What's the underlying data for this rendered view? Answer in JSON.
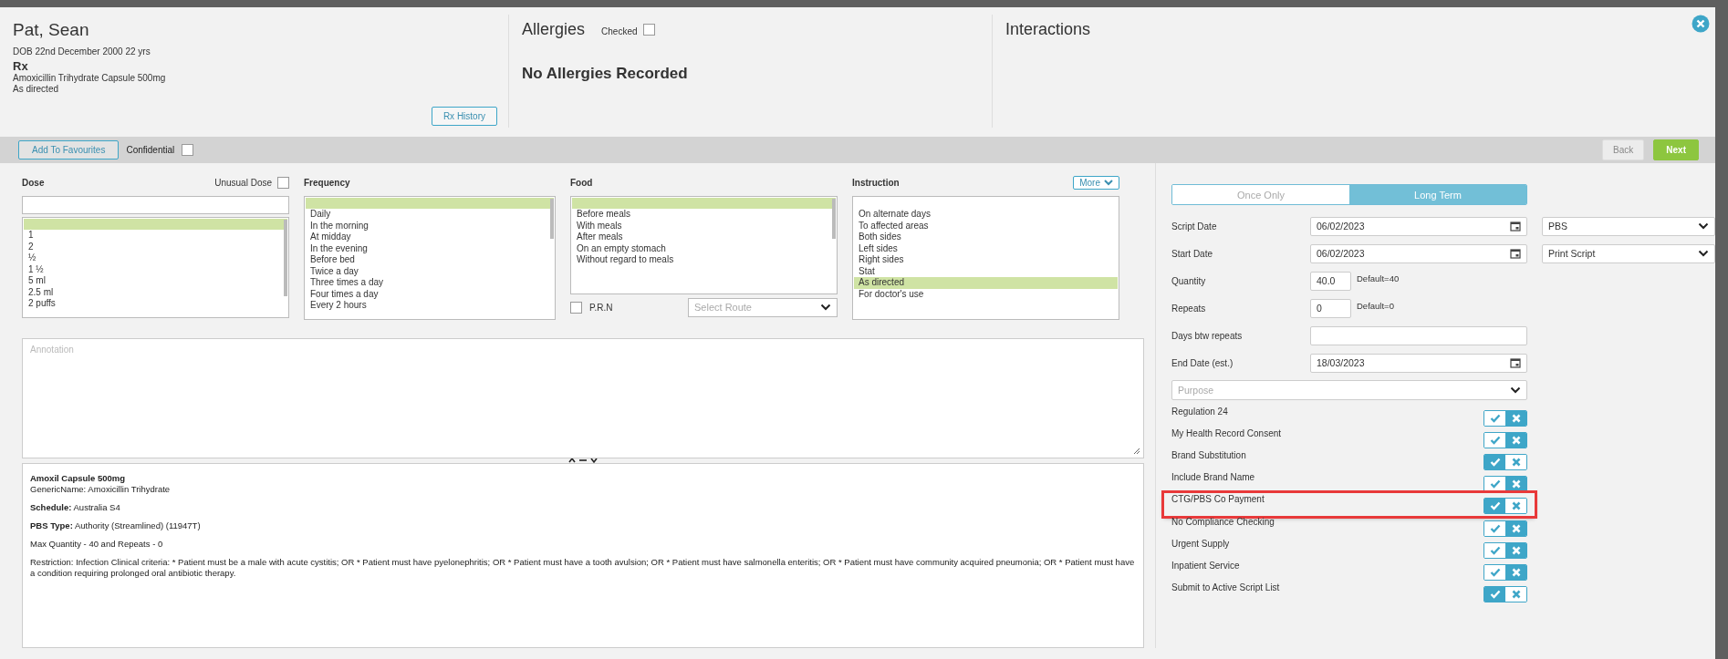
{
  "patient": {
    "name": "Pat, Sean",
    "dob": "DOB 22nd December 2000 22 yrs",
    "rx_heading": "Rx",
    "drug": "Amoxicillin Trihydrate Capsule 500mg",
    "directions": "As directed",
    "history_button": "Rx History"
  },
  "allergies": {
    "title": "Allergies",
    "checked_label": "Checked",
    "checked": false,
    "message": "No Allergies Recorded"
  },
  "interactions": {
    "title": "Interactions"
  },
  "toolbar": {
    "favourites_button": "Add To Favourites",
    "confidential_label": "Confidential",
    "confidential": false,
    "back_button": "Back",
    "next_button": "Next"
  },
  "dose": {
    "title": "Dose",
    "unusual_label": "Unusual Dose",
    "unusual": false,
    "blank_row": {
      "selected": true
    },
    "items": [
      {
        "label": "1",
        "selected": false
      },
      {
        "label": "2",
        "selected": false
      },
      {
        "label": "½",
        "selected": false
      },
      {
        "label": "1 ½",
        "selected": false
      },
      {
        "label": "5 ml",
        "selected": false
      },
      {
        "label": "2.5 ml",
        "selected": false
      },
      {
        "label": "2 puffs",
        "selected": false
      }
    ]
  },
  "frequency": {
    "title": "Frequency",
    "blank_row": {
      "selected": true
    },
    "items": [
      {
        "label": "Daily",
        "selected": false
      },
      {
        "label": "In the morning",
        "selected": false
      },
      {
        "label": "At midday",
        "selected": false
      },
      {
        "label": "In the evening",
        "selected": false
      },
      {
        "label": "Before bed",
        "selected": false
      },
      {
        "label": "Twice a day",
        "selected": false
      },
      {
        "label": "Three times a day",
        "selected": false
      },
      {
        "label": "Four times a day",
        "selected": false
      },
      {
        "label": "Every 2 hours",
        "selected": false
      }
    ]
  },
  "food": {
    "title": "Food",
    "blank_row": {
      "selected": true
    },
    "items": [
      {
        "label": "Before meals",
        "selected": false
      },
      {
        "label": "With meals",
        "selected": false
      },
      {
        "label": "After meals",
        "selected": false
      },
      {
        "label": "On an empty stomach",
        "selected": false
      },
      {
        "label": "Without regard to meals",
        "selected": false
      }
    ],
    "prn_label": "P.R.N",
    "prn": false,
    "route_placeholder": "Select Route"
  },
  "instruction": {
    "title": "Instruction",
    "more_button": "More",
    "blank_row": {
      "selected": false
    },
    "items": [
      {
        "label": "On alternate days",
        "selected": false
      },
      {
        "label": "To affected areas",
        "selected": false
      },
      {
        "label": "Both sides",
        "selected": false
      },
      {
        "label": "Left sides",
        "selected": false
      },
      {
        "label": "Right sides",
        "selected": false
      },
      {
        "label": "Stat",
        "selected": false
      },
      {
        "label": "As directed",
        "selected": true
      },
      {
        "label": "For doctor's use",
        "selected": false
      }
    ]
  },
  "annotation": {
    "placeholder": "Annotation"
  },
  "drug_info": {
    "title": "Amoxil Capsule 500mg",
    "generic": "GenericName: Amoxicillin Trihydrate",
    "paragraphs": [
      "**Schedule:** Australia S4",
      "**PBS Type:** Authority (Streamlined) (11947T)",
      "Max Quantity - 40 and Repeats - 0",
      "Restriction: Infection Clinical criteria: * Patient must be a male with acute cystitis; OR * Patient must have pyelonephritis; OR * Patient must have a tooth avulsion; OR * Patient must have salmonella enteritis; OR * Patient must have community acquired pneumonia; OR * Patient must have a condition requiring prolonged oral antibiotic therapy."
    ]
  },
  "term_tabs": [
    {
      "label": "Once Only",
      "selected": false
    },
    {
      "label": "Long Term",
      "selected": true
    }
  ],
  "form_rows": [
    {
      "kind": "date",
      "label": "Script Date",
      "value": "06/02/2023",
      "side_select": "PBS"
    },
    {
      "kind": "date",
      "label": "Start Date",
      "value": "06/02/2023",
      "side_select": "Print Script"
    },
    {
      "kind": "number",
      "label": "Quantity",
      "value": "40.0",
      "hint": "Default=40"
    },
    {
      "kind": "number",
      "label": "Repeats",
      "value": "0",
      "hint": "Default=0"
    },
    {
      "kind": "text",
      "label": "Days btw repeats"
    },
    {
      "kind": "date",
      "label": "End Date (est.)",
      "value": "18/03/2023"
    }
  ],
  "purpose": {
    "placeholder": "Purpose"
  },
  "options": [
    {
      "label": "Regulation 24",
      "on": false,
      "highlighted": false
    },
    {
      "label": "My Health Record Consent",
      "on": false,
      "highlighted": false
    },
    {
      "label": "Brand Substitution",
      "on": true,
      "highlighted": false
    },
    {
      "label": "Include Brand Name",
      "on": false,
      "highlighted": false
    },
    {
      "label": "CTG/PBS Co Payment",
      "on": true,
      "highlighted": true
    },
    {
      "label": "No Compliance Checking",
      "on": false,
      "highlighted": false
    },
    {
      "label": "Urgent Supply",
      "on": false,
      "highlighted": false
    },
    {
      "label": "Inpatient Service",
      "on": false,
      "highlighted": false
    },
    {
      "label": "Submit to Active Script List",
      "on": true,
      "highlighted": false
    }
  ]
}
